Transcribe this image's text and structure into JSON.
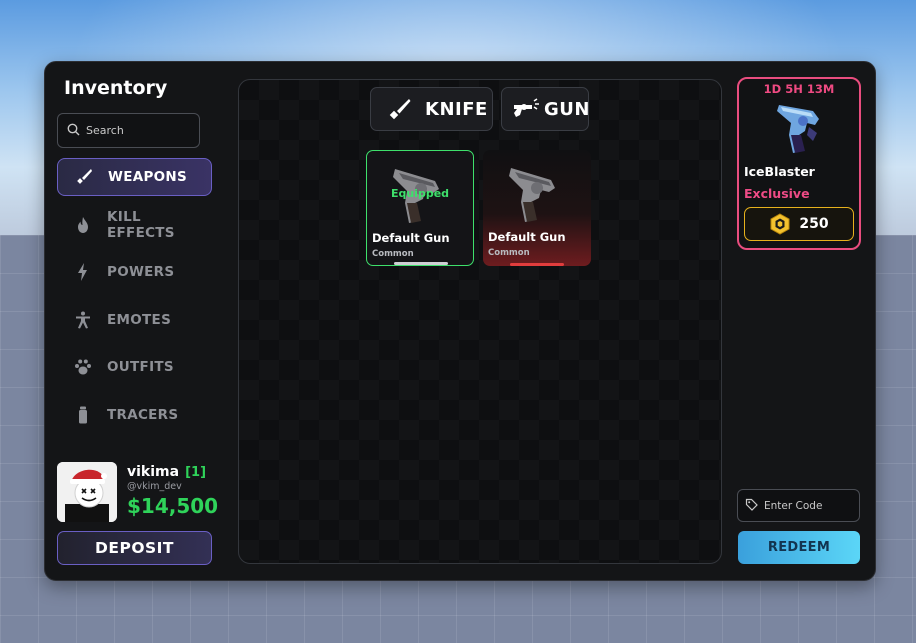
{
  "panel": {
    "title": "Inventory"
  },
  "search": {
    "placeholder": "Search",
    "icon": "search-icon"
  },
  "nav": {
    "items": [
      {
        "label": "WEAPONS",
        "icon": "knife-icon",
        "active": true
      },
      {
        "label": "KILL EFFECTS",
        "icon": "flame-icon",
        "active": false
      },
      {
        "label": "POWERS",
        "icon": "lightning-icon",
        "active": false
      },
      {
        "label": "EMOTES",
        "icon": "person-icon",
        "active": false
      },
      {
        "label": "OUTFITS",
        "icon": "paw-icon",
        "active": false
      },
      {
        "label": "TRACERS",
        "icon": "canister-icon",
        "active": false
      }
    ]
  },
  "profile": {
    "name": "vikima",
    "level": "[1]",
    "handle": "@vkim_dev",
    "money": "$14,500"
  },
  "deposit_label": "DEPOSIT",
  "tabs": [
    {
      "label": "KNIFE",
      "icon": "knife-icon"
    },
    {
      "label": "GUN",
      "icon": "revolver-icon"
    }
  ],
  "items": [
    {
      "name": "Default Gun",
      "rarity": "Common",
      "status": "Equipped"
    },
    {
      "name": "Default Gun",
      "rarity": "Common",
      "status": ""
    }
  ],
  "shop": {
    "timer": "1D 5H 13M",
    "name": "IceBlaster",
    "tag": "Exclusive",
    "price": "250",
    "currency_icon": "coin-icon"
  },
  "code": {
    "placeholder": "Enter Code",
    "icon": "tag-icon"
  },
  "redeem_label": "REDEEM",
  "colors": {
    "accent_green": "#2fd35a",
    "accent_pink": "#e94d7f",
    "accent_purple": "#6a5fc4",
    "accent_gold": "#e6b11d",
    "redeem_blue": "#5bd6f7"
  }
}
